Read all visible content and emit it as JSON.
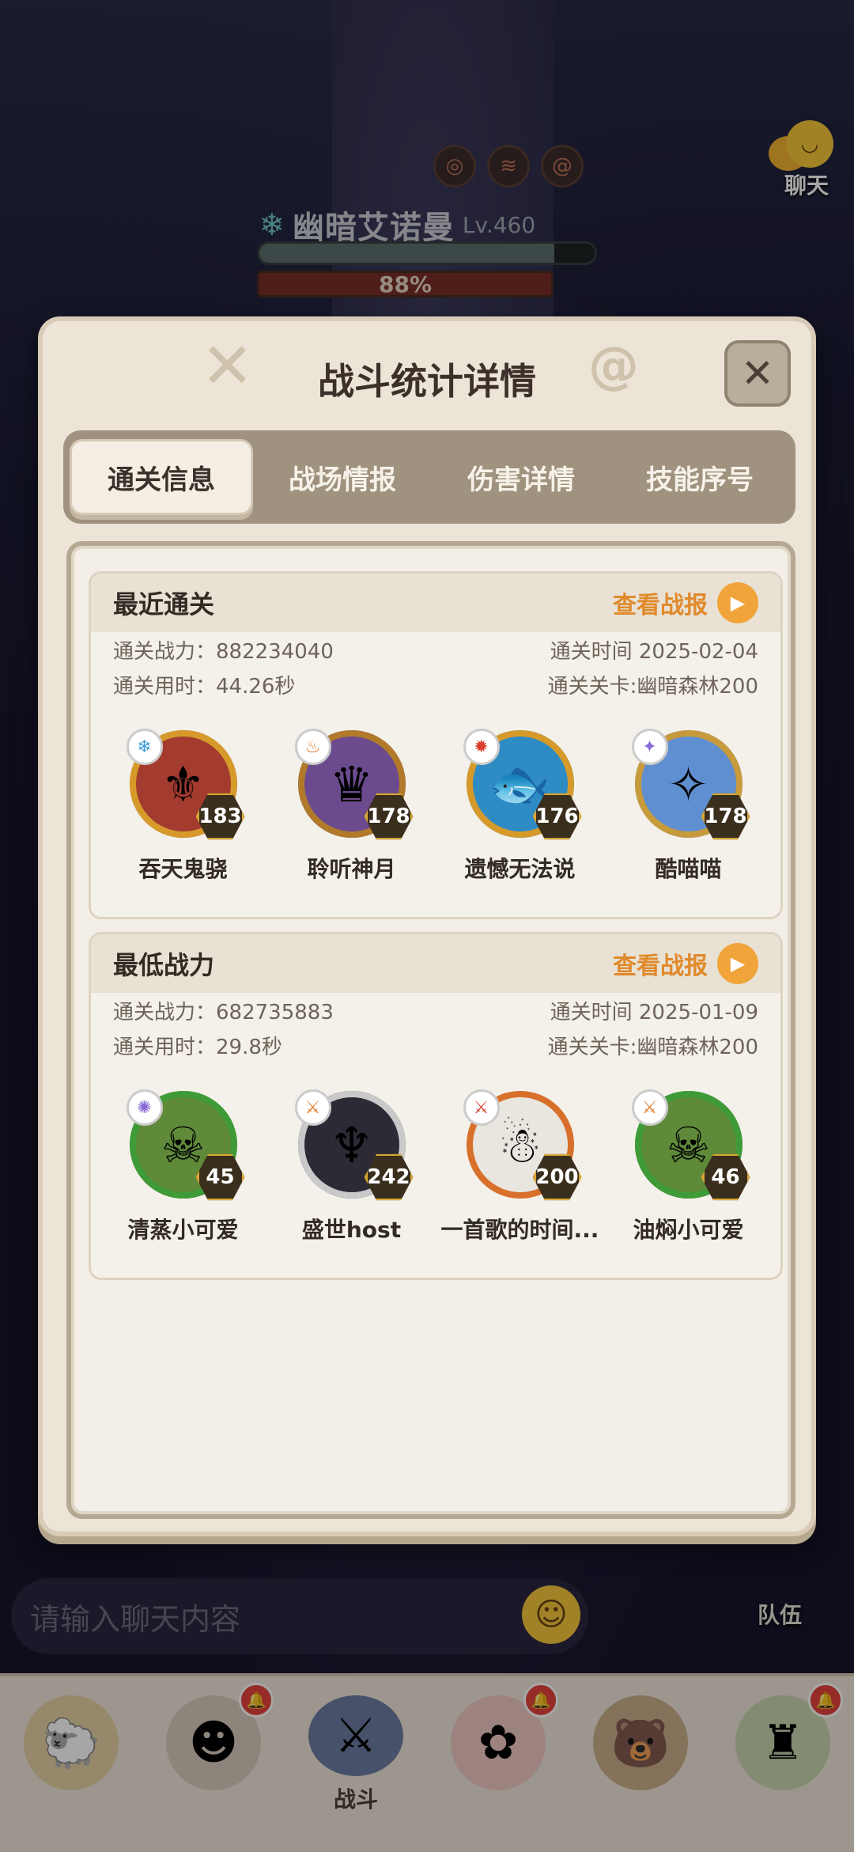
{
  "boss": {
    "name": "幽暗艾诺曼",
    "level": "Lv.460",
    "hp_percent_label": "88%",
    "hp_fraction": 0.88
  },
  "chat_button_label": "聊天",
  "chat_input_placeholder": "请输入聊天内容",
  "team_label": "队伍",
  "bottom_nav": {
    "battle_label": "战斗"
  },
  "dialog": {
    "title": "战斗统计详情",
    "tabs": [
      {
        "label": "通关信息",
        "active": true
      },
      {
        "label": "战场情报",
        "active": false
      },
      {
        "label": "伤害详情",
        "active": false
      },
      {
        "label": "技能序号",
        "active": false
      }
    ],
    "sections": [
      {
        "title": "最近通关",
        "view_report": "查看战报",
        "power": "通关战力：882234040",
        "time": "通关时间  2025-02-04",
        "duration": "通关用时：44.26秒",
        "stage": "通关关卡:幽暗森林200",
        "heroes": [
          {
            "name": "吞天鬼骁",
            "level": "183"
          },
          {
            "name": "聆听神月",
            "level": "178"
          },
          {
            "name": "遗憾无法说",
            "level": "176"
          },
          {
            "name": "酷喵喵",
            "level": "178"
          }
        ]
      },
      {
        "title": "最低战力",
        "view_report": "查看战报",
        "power": "通关战力：682735883",
        "time": "通关时间  2025-01-09",
        "duration": "通关用时：29.8秒",
        "stage": "通关关卡:幽暗森林200",
        "heroes": [
          {
            "name": "清蒸小可爱",
            "level": "45"
          },
          {
            "name": "盛世host",
            "level": "242"
          },
          {
            "name": "一首歌的时间...",
            "level": "200"
          },
          {
            "name": "油焖小可爱",
            "level": "46"
          }
        ]
      }
    ]
  },
  "colors": {
    "accent_orange": "#e08a2c",
    "tab_bar": "#9f937f",
    "dialog_bg": "#ece4d6"
  }
}
